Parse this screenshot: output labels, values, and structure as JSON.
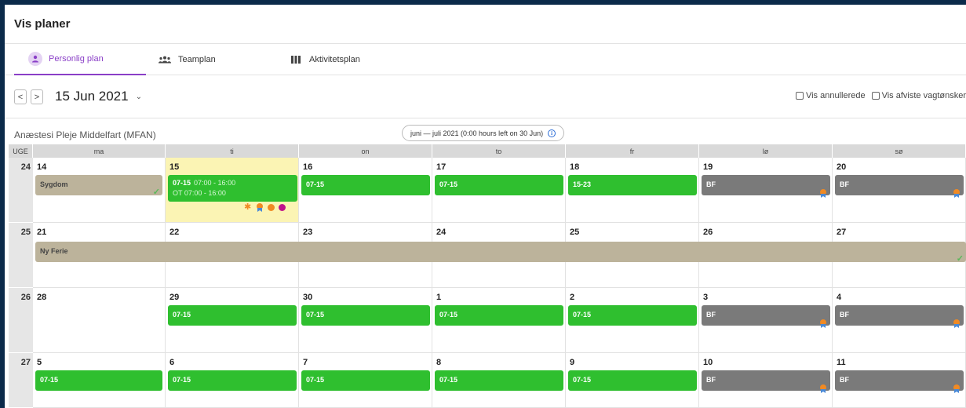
{
  "title": "Vis planer",
  "tabs": [
    {
      "label": "Personlig plan",
      "icon": "person-icon",
      "active": true
    },
    {
      "label": "Teamplan",
      "icon": "team-icon",
      "active": false
    },
    {
      "label": "Aktivitetsplan",
      "icon": "columns-icon",
      "active": false
    }
  ],
  "toolbar": {
    "prev": "<",
    "next": ">",
    "date": "15 Jun 2021",
    "caret": "⌄",
    "checks": [
      "Vis annullerede",
      "Vis afviste vagtønsker"
    ]
  },
  "info": {
    "unit": "Anæstesi Pleje Middelfart (MFAN)",
    "period": "juni — juli 2021 (0:00 hours left on 30 Jun)",
    "info_icon": "i"
  },
  "calendar": {
    "week_header": "UGE",
    "days": [
      "ma",
      "ti",
      "on",
      "to",
      "fr",
      "lø",
      "sø"
    ],
    "weeks": [
      {
        "week": "24",
        "dates": [
          "14",
          "15",
          "16",
          "17",
          "18",
          "19",
          "20"
        ]
      },
      {
        "week": "25",
        "dates": [
          "21",
          "22",
          "23",
          "24",
          "25",
          "26",
          "27"
        ]
      },
      {
        "week": "26",
        "dates": [
          "28",
          "29",
          "30",
          "1",
          "2",
          "3",
          "4"
        ]
      },
      {
        "week": "27",
        "dates": [
          "5",
          "6",
          "7",
          "8",
          "9",
          "10",
          "11"
        ]
      }
    ],
    "today": {
      "week": 0,
      "day": 1
    },
    "shifts": {
      "sygdom": "Sygdom",
      "ny_ferie": "Ny Ferie",
      "s0715": "07-15",
      "s0715_time": "07:00 - 16:00",
      "ot": "OT 07:00 - 16:00",
      "s1523": "15-23",
      "bf": "BF",
      "check": "✓",
      "sun": "✱"
    }
  },
  "colors": {
    "accent": "#8a3fc7",
    "green": "#2fbf2f",
    "gray": "#7a7a7a",
    "tan": "#bcb39b",
    "today": "#fbf4b4"
  }
}
